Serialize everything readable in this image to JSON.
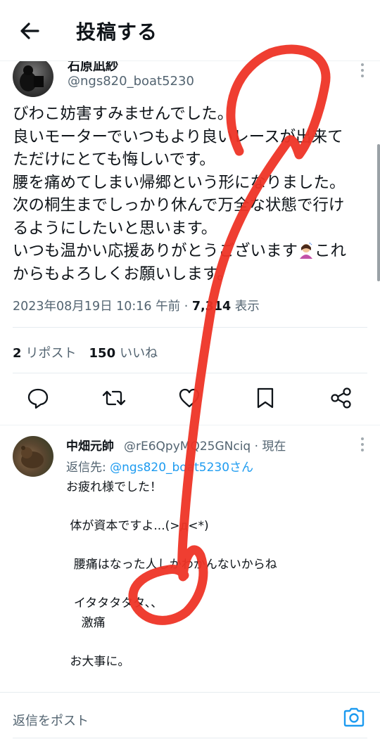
{
  "header": {
    "title": "投稿する",
    "back_icon": "arrow-left-icon"
  },
  "post": {
    "author_name": "石原凪紗",
    "author_handle": "@ngs820_boat5230",
    "body_lines": [
      "びわこ妨害すみませんでした。",
      "良いモーターでいつもより良いレースが出来て",
      "ただけにとても悔しいです。",
      "腰を痛めてしまい帰郷という形になりました。",
      "次の桐生までしっかり休んで万全な状態で行け",
      "るようにしたいと思います。",
      "いつも温かい応援ありがとうございます",
      "からもよろしくお願いします。"
    ],
    "line7_tail": "これ",
    "meta_date": "2023年08月19日 10:16 午前 · ",
    "meta_views_count": "7,314",
    "meta_views_label": " 表示",
    "reposts_count": "2",
    "reposts_label": "リポスト",
    "likes_count": "150",
    "likes_label": "いいね"
  },
  "actions": [
    "reply-icon",
    "repost-icon",
    "like-icon",
    "bookmark-icon",
    "share-icon"
  ],
  "reply": {
    "author_name": "中畑元帥",
    "author_handle": "@rE6QpyMQ25GNciq · 現在",
    "reply_to_label": "返信先: ",
    "reply_to_handle": "@ngs820_boat5230さん",
    "body": "お疲れ様でした！\n\n 体が資本ですよ...(>д<*)\n\n  腰痛はなった人しかわかんないからね\n\n  イタタタタタ、、\n    激痛\n\n お大事に。"
  },
  "bottom": {
    "placeholder": "返信をポスト",
    "camera_icon": "camera-icon"
  },
  "colors": {
    "accent": "#1d9bf0",
    "scribble": "#ef3b2c",
    "muted": "#536471"
  }
}
